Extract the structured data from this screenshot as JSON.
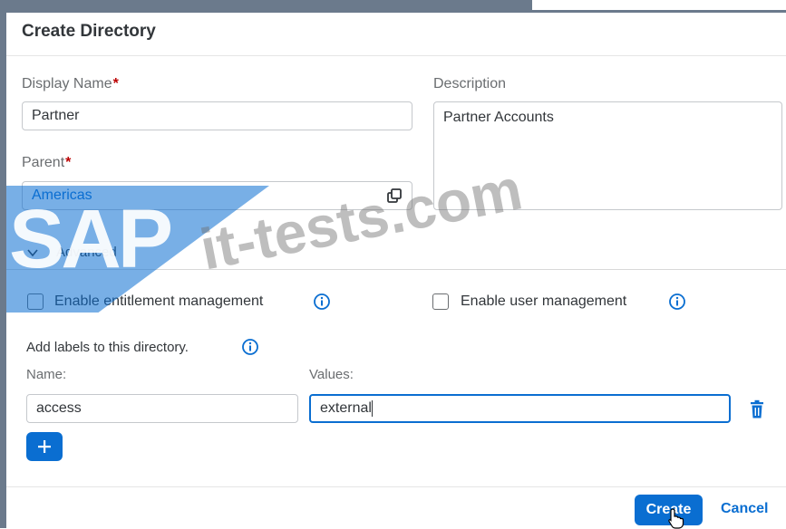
{
  "dialog": {
    "title": "Create Directory",
    "display_name_label": "Display Name",
    "display_name_value": "Partner",
    "parent_label": "Parent",
    "parent_value": "Americas",
    "description_label": "Description",
    "description_value": "Partner Accounts",
    "required_marker": "*",
    "advanced_label": "Advanced",
    "enable_entitlement_label": "Enable entitlement management",
    "enable_entitlement_checked": false,
    "enable_user_mgmt_label": "Enable user management",
    "enable_user_mgmt_checked": false,
    "labels_heading": "Add labels to this directory.",
    "labels_name_header": "Name:",
    "labels_values_header": "Values:",
    "labels": [
      {
        "name": "access",
        "value": "external"
      }
    ],
    "create_label": "Create",
    "cancel_label": "Cancel"
  },
  "watermark": {
    "brand": "SAP",
    "site": "it-tests.com"
  },
  "icons": {
    "valuehelp": "value-help-icon",
    "info": "info-icon",
    "add": "plus-icon",
    "delete": "trash-icon",
    "advanced": "chevron-down-icon"
  },
  "colors": {
    "accent": "#0a6ed1",
    "required": "#bb0000",
    "label": "#6a6d70",
    "text": "#32363a"
  }
}
